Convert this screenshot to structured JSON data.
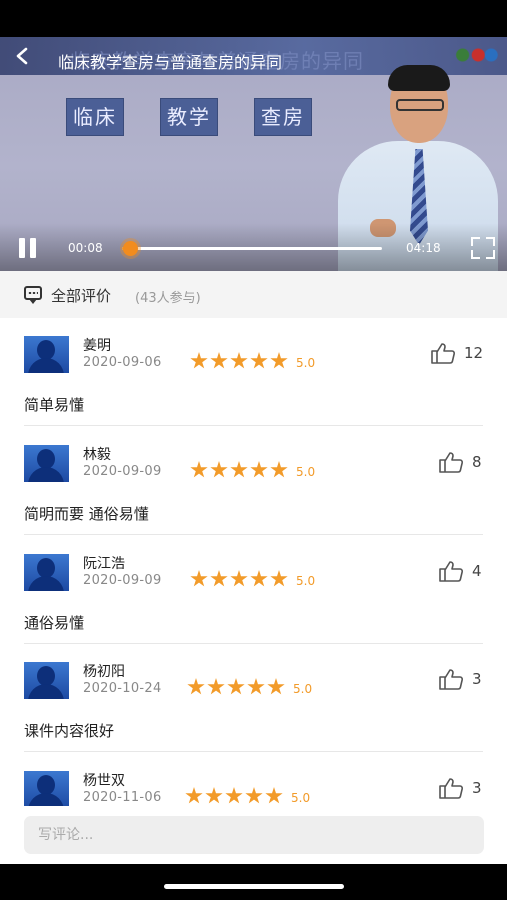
{
  "video": {
    "title": "临床教学查房与普通查房的异同",
    "ghost_title": "临床教学查房与普通查房的异同",
    "board_words": [
      "临床",
      "教学",
      "查房"
    ],
    "current_time": "00:08",
    "total_time": "04:18",
    "progress": 0.031,
    "icons": {
      "back": "back-arrow-icon",
      "play": "pause-icon",
      "fullscreen": "fullscreen-icon"
    },
    "accent_color": "#f28c1e"
  },
  "comments_section": {
    "title": "全部评价",
    "count_text": "(43人参与)",
    "icon": "comment-icon"
  },
  "reviews": [
    {
      "name": "姜明",
      "date": "2020-09-06",
      "rating": 5,
      "score": "5.0",
      "likes": "12",
      "text": "简单易懂"
    },
    {
      "name": "林毅",
      "date": "2020-09-09",
      "rating": 5,
      "score": "5.0",
      "likes": "8",
      "text": "简明而要 通俗易懂"
    },
    {
      "name": "阮江浩",
      "date": "2020-09-09",
      "rating": 5,
      "score": "5.0",
      "likes": "4",
      "text": "通俗易懂"
    },
    {
      "name": "杨初阳",
      "date": "2020-10-24",
      "rating": 5,
      "score": "5.0",
      "likes": "3",
      "text": "课件内容很好"
    },
    {
      "name": "杨世双",
      "date": "2020-11-06",
      "rating": 5,
      "score": "5.0",
      "likes": "3",
      "text": ""
    }
  ],
  "comment_input": {
    "placeholder": "写评论...",
    "value": ""
  },
  "star_color": "#f29b2a"
}
